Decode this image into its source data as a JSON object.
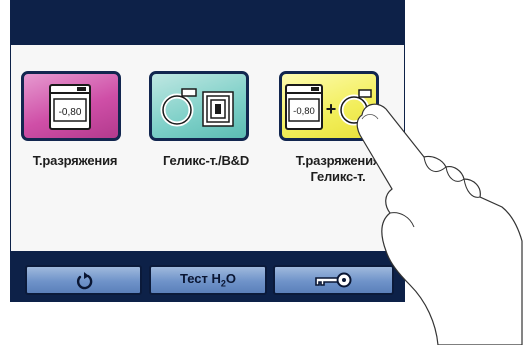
{
  "programs": [
    {
      "label": "Т.разряжения",
      "icon": "vacuum-test-icon",
      "display_value": "-0,80",
      "color": "#cf4fa7"
    },
    {
      "label": "Геликс-т./B&D",
      "icon": "helix-bowie-dick-icon",
      "color": "#7ccfc7"
    },
    {
      "label": "Т.разряжения Геликс-т.",
      "icon": "vacuum-plus-helix-icon",
      "display_value": "-0,80",
      "color": "#f2ee5a"
    }
  ],
  "toolbar": {
    "back_icon": "back-arrow-icon",
    "test_label_main": "Тест H",
    "test_label_sub": "2",
    "test_label_end": "O",
    "key_icon": "key-icon"
  },
  "colors": {
    "frame": "#0d2148",
    "button": "#6f93c9"
  }
}
